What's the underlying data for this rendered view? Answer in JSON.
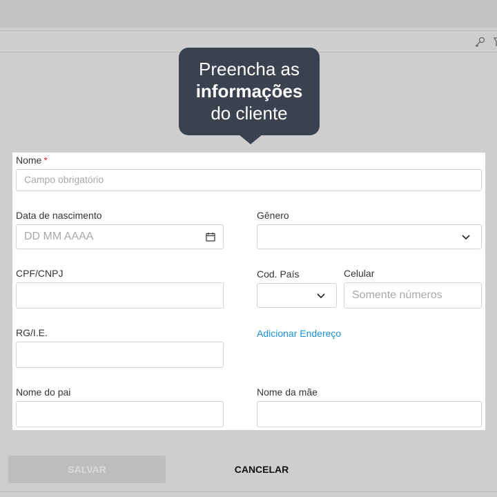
{
  "tooltip": {
    "line1": "Preencha as",
    "line2": "informações",
    "line3": "do cliente"
  },
  "toolbar": {
    "icons": [
      "key-icon",
      "pin-icon"
    ]
  },
  "form": {
    "nome": {
      "label": "Nome",
      "required_mark": "*",
      "placeholder": "Campo obrigatório",
      "value": ""
    },
    "data_nascimento": {
      "label": "Data de nascimento",
      "placeholder": "DD MM AAAA",
      "value": "",
      "icon": "calendar-icon"
    },
    "genero": {
      "label": "Gênero",
      "value": "",
      "icon": "chevron-down-icon"
    },
    "cpf_cnpj": {
      "label": "CPF/CNPJ",
      "value": ""
    },
    "cod_pais": {
      "label": "Cod. País",
      "value": "",
      "icon": "chevron-down-icon"
    },
    "celular": {
      "label": "Celular",
      "placeholder": "Somente números",
      "value": ""
    },
    "rg_ie": {
      "label": "RG/I.E.",
      "value": ""
    },
    "add_address_link": "Adicionar Endereço",
    "nome_pai": {
      "label": "Nome do pai",
      "value": ""
    },
    "nome_mae": {
      "label": "Nome da mãe",
      "value": ""
    }
  },
  "footer": {
    "save_label": "SALVAR",
    "cancel_label": "CANCELAR"
  },
  "colors": {
    "tooltip_bg": "#3a4250",
    "link": "#1a8fd8",
    "required": "#e0212f",
    "overlay": "#cecece"
  }
}
